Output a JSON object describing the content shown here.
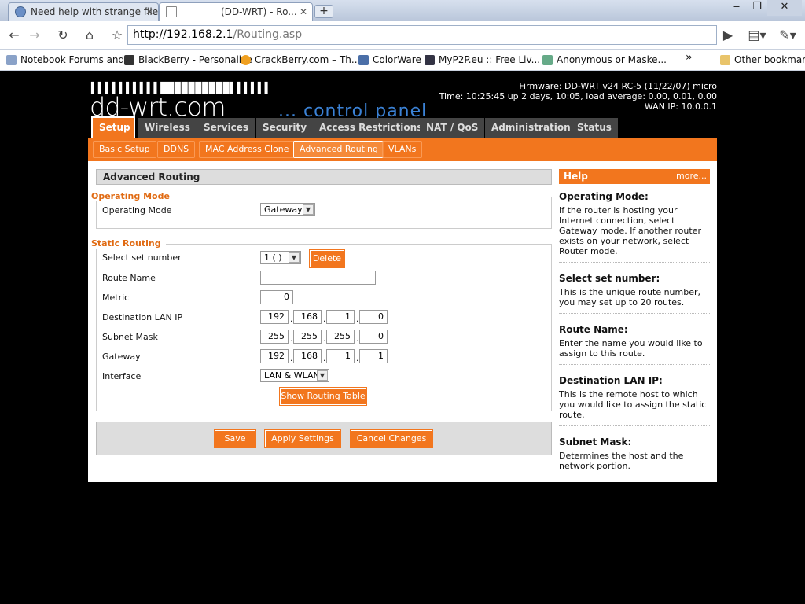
{
  "browser": {
    "tabs": [
      {
        "title": "Need help with strange file..."
      },
      {
        "title": "(DD-WRT) - Ro..."
      }
    ],
    "url_host": "http://192.168.2.1",
    "url_path": "/Routing.asp",
    "bookmarks": [
      "Notebook Forums and...",
      "BlackBerry - Personalize",
      "CrackBerry.com – Th...",
      "ColorWare",
      "MyP2P.eu :: Free Liv...",
      "Anonymous or Maske..."
    ],
    "other_bookmarks": "Other bookmarks",
    "overflow": "»"
  },
  "header": {
    "dashes": "▌▌▌▌▌▌▌▌▌▌██████████▌▌▌▌▌▌",
    "logo": "dd-wrt.com",
    "control_panel": "... control panel",
    "firmware": "Firmware: DD-WRT v24 RC-5 (11/22/07) micro",
    "time": "Time: 10:25:45 up 2 days, 10:05, load average: 0.00, 0.01, 0.00",
    "wan_ip": "WAN IP: 10.0.0.1"
  },
  "main_tabs": [
    "Setup",
    "Wireless",
    "Services",
    "Security",
    "Access Restrictions",
    "NAT / QoS",
    "Administration",
    "Status"
  ],
  "sub_tabs": [
    "Basic Setup",
    "DDNS",
    "MAC Address Clone",
    "Advanced Routing",
    "VLANs"
  ],
  "section_title": "Advanced Routing",
  "operating_mode": {
    "legend": "Operating Mode",
    "label": "Operating Mode",
    "value": "Gateway"
  },
  "static_routing": {
    "legend": "Static Routing",
    "set_number_label": "Select set number",
    "set_number_value": "1 ( )",
    "delete_label": "Delete",
    "route_name_label": "Route Name",
    "route_name_value": "",
    "metric_label": "Metric",
    "metric_value": "0",
    "dest_lan_ip_label": "Destination LAN IP",
    "dest_lan_ip": [
      "192",
      "168",
      "1",
      "0"
    ],
    "subnet_mask_label": "Subnet Mask",
    "subnet_mask": [
      "255",
      "255",
      "255",
      "0"
    ],
    "gateway_label": "Gateway",
    "gateway": [
      "192",
      "168",
      "1",
      "1"
    ],
    "interface_label": "Interface",
    "interface_value": "LAN & WLAN",
    "show_table_label": "Show Routing Table"
  },
  "footer_buttons": {
    "save": "Save",
    "apply": "Apply Settings",
    "cancel": "Cancel Changes"
  },
  "help": {
    "title": "Help",
    "more": "more...",
    "items": [
      {
        "title": "Operating Mode:",
        "text": "If the router is hosting your Internet connection, select Gateway mode. If another router exists on your network, select Router mode."
      },
      {
        "title": "Select set number:",
        "text": "This is the unique route number, you may set up to 20 routes."
      },
      {
        "title": "Route Name:",
        "text": "Enter the name you would like to assign to this route."
      },
      {
        "title": "Destination LAN IP:",
        "text": "This is the remote host to which you would like to assign the static route."
      },
      {
        "title": "Subnet Mask:",
        "text": "Determines the host and the network portion."
      }
    ]
  }
}
